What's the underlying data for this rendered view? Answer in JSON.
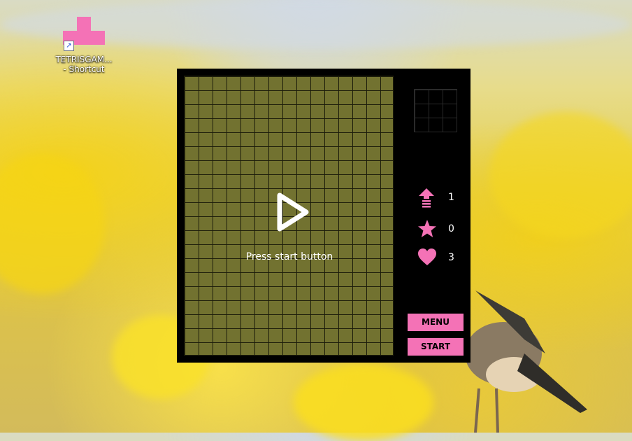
{
  "desktop": {
    "shortcut": {
      "label_line1": "TETRISGAM...",
      "label_line2": "- Shortcut",
      "icon": "tetromino-t-icon",
      "color": "#f472b6"
    }
  },
  "game": {
    "board": {
      "columns": 15,
      "rows": 20,
      "color": "#727230"
    },
    "overlay": {
      "icon": "play-icon",
      "message": "Press start button"
    },
    "next_piece_preview": {
      "columns": 3,
      "rows": 3
    },
    "stats": {
      "level": {
        "icon": "level-up-icon",
        "value": "1"
      },
      "score": {
        "icon": "star-icon",
        "value": "0"
      },
      "lives": {
        "icon": "heart-icon",
        "value": "3"
      }
    },
    "buttons": {
      "menu": "MENU",
      "start": "START"
    },
    "accent_color": "#f472b6"
  }
}
